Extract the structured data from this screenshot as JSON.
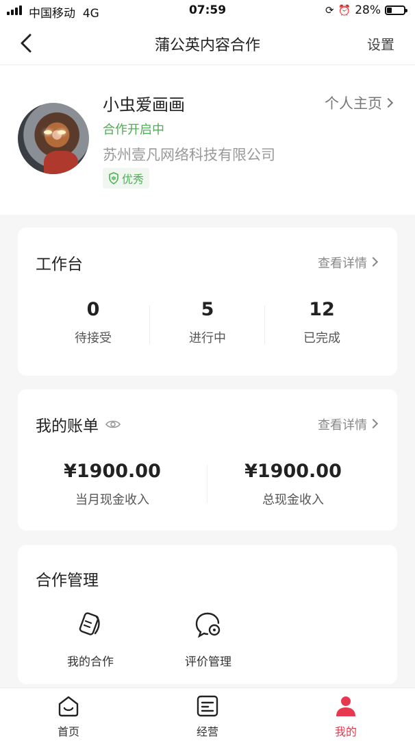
{
  "status": {
    "carrier": "中国移动",
    "network": "4G",
    "time": "07:59",
    "battery": "28%",
    "battery_level": 0.28
  },
  "nav": {
    "title": "蒲公英内容合作",
    "settings": "设置"
  },
  "profile": {
    "name": "小虫爱画画",
    "homepage_link": "个人主页",
    "coop_status": "合作开启中",
    "company": "苏州壹凡网络科技有限公司",
    "badge": "优秀"
  },
  "workbench": {
    "title": "工作台",
    "detail_link": "查看详情",
    "stats": [
      {
        "value": "0",
        "label": "待接受"
      },
      {
        "value": "5",
        "label": "进行中"
      },
      {
        "value": "12",
        "label": "已完成"
      }
    ]
  },
  "bill": {
    "title": "我的账单",
    "detail_link": "查看详情",
    "items": [
      {
        "value": "¥1900.00",
        "label": "当月现金收入"
      },
      {
        "value": "¥1900.00",
        "label": "总现金收入"
      }
    ]
  },
  "coop_mgmt": {
    "title": "合作管理",
    "items": [
      {
        "label": "我的合作",
        "icon": "cards-icon"
      },
      {
        "label": "评价管理",
        "icon": "chat-review-icon"
      }
    ]
  },
  "tabbar": {
    "tabs": [
      {
        "label": "首页",
        "icon": "home-icon"
      },
      {
        "label": "经营",
        "icon": "business-icon"
      },
      {
        "label": "我的",
        "icon": "person-icon"
      }
    ],
    "active_index": 2
  },
  "colors": {
    "accent_red": "#e8384f",
    "green": "#4caf50"
  }
}
